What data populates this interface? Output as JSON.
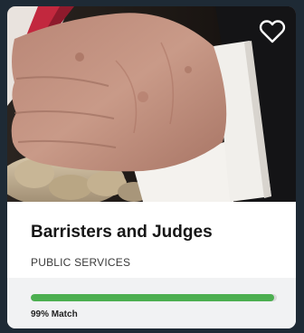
{
  "card": {
    "title": "Barristers and Judges",
    "category": "PUBLIC SERVICES",
    "favorite_icon": "heart-outline-icon",
    "match": {
      "value": 0.99,
      "label": "99% Match",
      "color": "#4caf50"
    }
  }
}
